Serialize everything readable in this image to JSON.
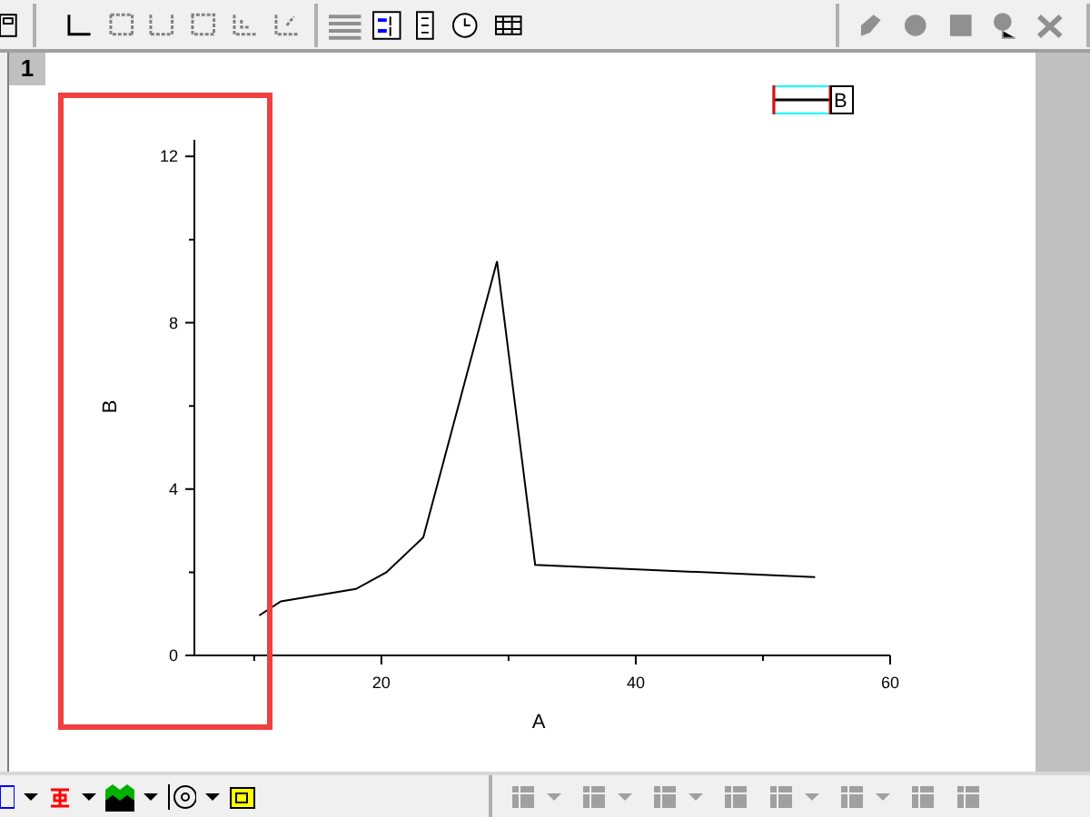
{
  "graph_window": {
    "tab": "1"
  },
  "chart_data": {
    "type": "line",
    "xlabel": "A",
    "ylabel": "B",
    "xlim": [
      5.3,
      60
    ],
    "ylim": [
      0,
      12.4
    ],
    "xticks": [
      20,
      40,
      60
    ],
    "yticks": [
      0,
      4,
      8,
      12
    ],
    "x": [
      10.4,
      12.1,
      18,
      20.4,
      23.3,
      29.1,
      32.1,
      54.1
    ],
    "series": [
      {
        "name": "B",
        "color": "#000000",
        "values": [
          0.96,
          1.3,
          1.6,
          2.0,
          2.84,
          9.48,
          2.18,
          1.88
        ]
      }
    ]
  }
}
